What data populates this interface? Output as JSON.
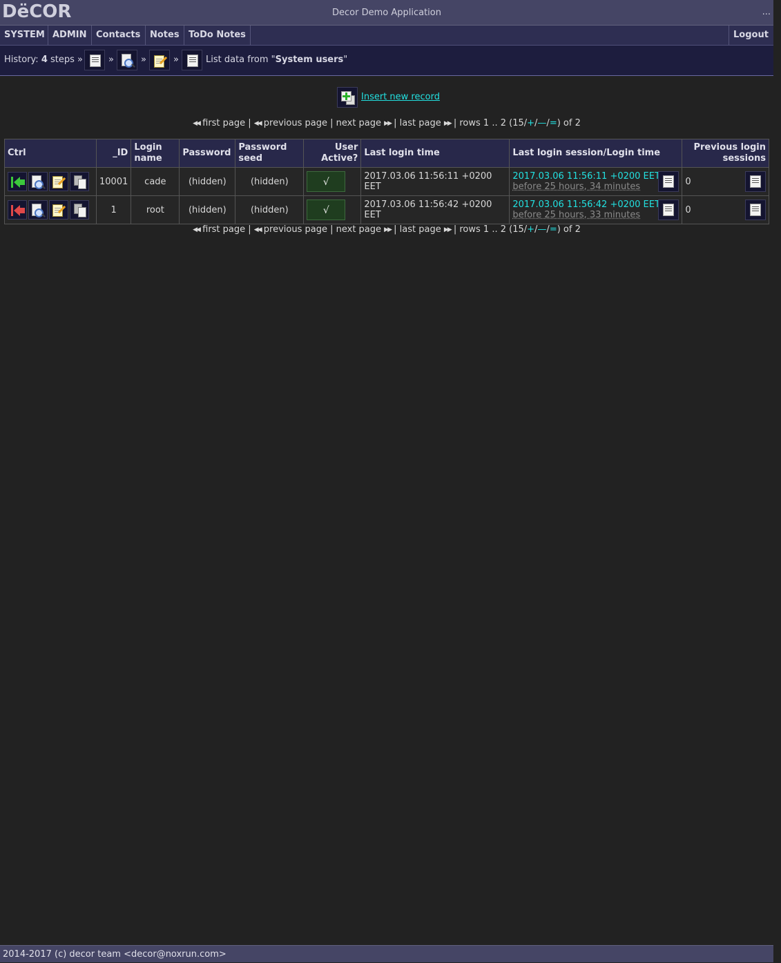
{
  "header": {
    "logo": "DëCOR",
    "app_title": "Decor Demo Application",
    "overflow": "..."
  },
  "menu": {
    "items": [
      "SYSTEM",
      "ADMIN",
      "Contacts",
      "Notes",
      "ToDo Notes"
    ],
    "logout": "Logout"
  },
  "history": {
    "prefix": "History:",
    "count": "4",
    "suffix": "steps »",
    "separator": "»",
    "steps": [
      "list-icon",
      "view-icon",
      "edit-icon",
      "list-icon"
    ],
    "current_prefix": "List data from \"",
    "current_table": "System users",
    "current_suffix": "\""
  },
  "insert": {
    "label": "Insert new record"
  },
  "pager": {
    "first": "first page",
    "previous": "previous page",
    "next": "next page",
    "last": "last page",
    "rows_text": "rows 1 .. 2 (15/",
    "plus": "+",
    "minus": "—",
    "equal": "=",
    "of_text": ") of 2"
  },
  "table": {
    "columns": [
      "Ctrl",
      "_ID",
      "Login name",
      "Password",
      "Password seed",
      "User Active?",
      "Last login time",
      "Last login session/Login time",
      "Previous login sessions"
    ],
    "rows": [
      {
        "id": "10001",
        "login": "cade",
        "password": "(hidden)",
        "seed": "(hidden)",
        "active": "√",
        "last_login": "2017.03.06 11:56:11 +0200 EET",
        "session_time": "2017.03.06 11:56:11 +0200 EET",
        "session_ago": "before 25 hours, 34 minutes",
        "prev_sessions": "0",
        "select_color": "#3cc83c"
      },
      {
        "id": "1",
        "login": "root",
        "password": "(hidden)",
        "seed": "(hidden)",
        "active": "√",
        "last_login": "2017.03.06 11:56:42 +0200 EET",
        "session_time": "2017.03.06 11:56:42 +0200 EET",
        "session_ago": "before 25 hours, 33 minutes",
        "prev_sessions": "0",
        "select_color": "#e04848"
      }
    ]
  },
  "footer": {
    "text": "2014-2017 (c) decor team <decor@noxrun.com>"
  },
  "colors": {
    "background": "#222222",
    "link": "#22e0e0",
    "header": "#454565",
    "menubar": "#2e2e52"
  }
}
